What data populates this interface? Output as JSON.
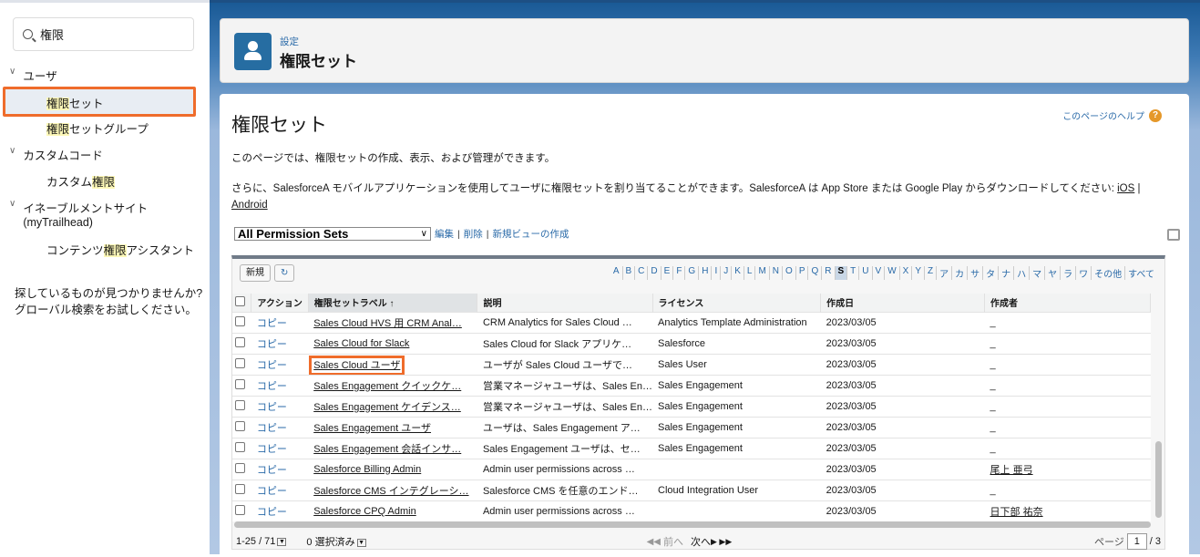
{
  "sidebar": {
    "search_value": "権限",
    "groups": [
      {
        "label": "ユーザ",
        "items": [
          {
            "hl": "権限",
            "rest": "セット"
          },
          {
            "hl": "権限",
            "rest": "セットグループ"
          }
        ]
      },
      {
        "label": "カスタムコード",
        "items": [
          {
            "pre": "カスタム",
            "hl": "権限"
          }
        ]
      },
      {
        "label": "イネーブルメントサイト",
        "label2": "(myTrailhead)",
        "items": [
          {
            "pre": "コンテンツ",
            "hl": "権限",
            "rest": "アシスタント"
          }
        ]
      }
    ],
    "help_line1": "探しているものが見つかりませんか?",
    "help_line2": "グローバル検索をお試しください。"
  },
  "header": {
    "breadcrumb": "設定",
    "title": "権限セット"
  },
  "page": {
    "title": "権限セット",
    "help_link": "このページのヘルプ",
    "help_icon": "?",
    "intro": "このページでは、権限セットの作成、表示、および管理ができます。",
    "mobile_text": "さらに、SalesforceA モバイルアプリケーションを使用してユーザに権限セットを割り当てることができます。SalesforceA は App Store または Google Play からダウンロードしてください: ",
    "ios": "iOS",
    "sep": " | ",
    "android": "Android"
  },
  "view": {
    "selected": "All Permission Sets",
    "edit": "編集",
    "delete": "削除",
    "new_view": "新規ビューの作成",
    "pipe": "|"
  },
  "toolbar": {
    "new_button": "新規",
    "refresh_icon": "↻"
  },
  "alphabet": [
    "A",
    "B",
    "C",
    "D",
    "E",
    "F",
    "G",
    "H",
    "I",
    "J",
    "K",
    "L",
    "M",
    "N",
    "O",
    "P",
    "Q",
    "R",
    "S",
    "T",
    "U",
    "V",
    "W",
    "X",
    "Y",
    "Z",
    "ア",
    "カ",
    "サ",
    "タ",
    "ナ",
    "ハ",
    "マ",
    "ヤ",
    "ラ",
    "ワ",
    "その他",
    "すべて"
  ],
  "alphabet_active": "S",
  "columns": [
    "アクション",
    "権限セットラベル ↑",
    "説明",
    "ライセンス",
    "作成日",
    "作成者"
  ],
  "rows": [
    {
      "action": "コピー",
      "label": "Sales Cloud HVS 用 CRM Anal…",
      "desc": "CRM Analytics for Sales Cloud …",
      "license": "Analytics Template Administration",
      "date": "2023/03/05",
      "creator": "_"
    },
    {
      "action": "コピー",
      "label": "Sales Cloud for Slack",
      "desc": "Sales Cloud for Slack アプリケ…",
      "license": "Salesforce",
      "date": "2023/03/05",
      "creator": "_"
    },
    {
      "action": "コピー",
      "label": "Sales Cloud ユーザ",
      "desc": "ユーザが Sales Cloud ユーザで…",
      "license": "Sales User",
      "date": "2023/03/05",
      "creator": "_"
    },
    {
      "action": "コピー",
      "label": "Sales Engagement クイックケ…",
      "desc": "営業マネージャユーザは、Sales En…",
      "license": "Sales Engagement",
      "date": "2023/03/05",
      "creator": "_"
    },
    {
      "action": "コピー",
      "label": "Sales Engagement ケイデンス…",
      "desc": "営業マネージャユーザは、Sales En…",
      "license": "Sales Engagement",
      "date": "2023/03/05",
      "creator": "_"
    },
    {
      "action": "コピー",
      "label": "Sales Engagement ユーザ",
      "desc": "ユーザは、Sales Engagement ア…",
      "license": "Sales Engagement",
      "date": "2023/03/05",
      "creator": "_"
    },
    {
      "action": "コピー",
      "label": "Sales Engagement 会話インサ…",
      "desc": "Sales Engagement ユーザは、セ…",
      "license": "Sales Engagement",
      "date": "2023/03/05",
      "creator": "_"
    },
    {
      "action": "コピー",
      "label": "Salesforce Billing Admin",
      "desc": "Admin user permissions across …",
      "license": "",
      "date": "2023/03/05",
      "creator": "尾上 亜弓"
    },
    {
      "action": "コピー",
      "label": "Salesforce CMS インテグレーシ…",
      "desc": "Salesforce CMS を任意のエンド…",
      "license": "Cloud Integration User",
      "date": "2023/03/05",
      "creator": "_"
    },
    {
      "action": "コピー",
      "label": "Salesforce CPQ Admin",
      "desc": "Admin user permissions across …",
      "license": "",
      "date": "2023/03/05",
      "creator": "日下部 祐奈"
    }
  ],
  "footer": {
    "range": "1-25 / 71",
    "selected": "0 選択済み",
    "prev": "前へ",
    "next": "次へ",
    "page_label": "ページ",
    "page": "1",
    "total": "/ 3"
  }
}
